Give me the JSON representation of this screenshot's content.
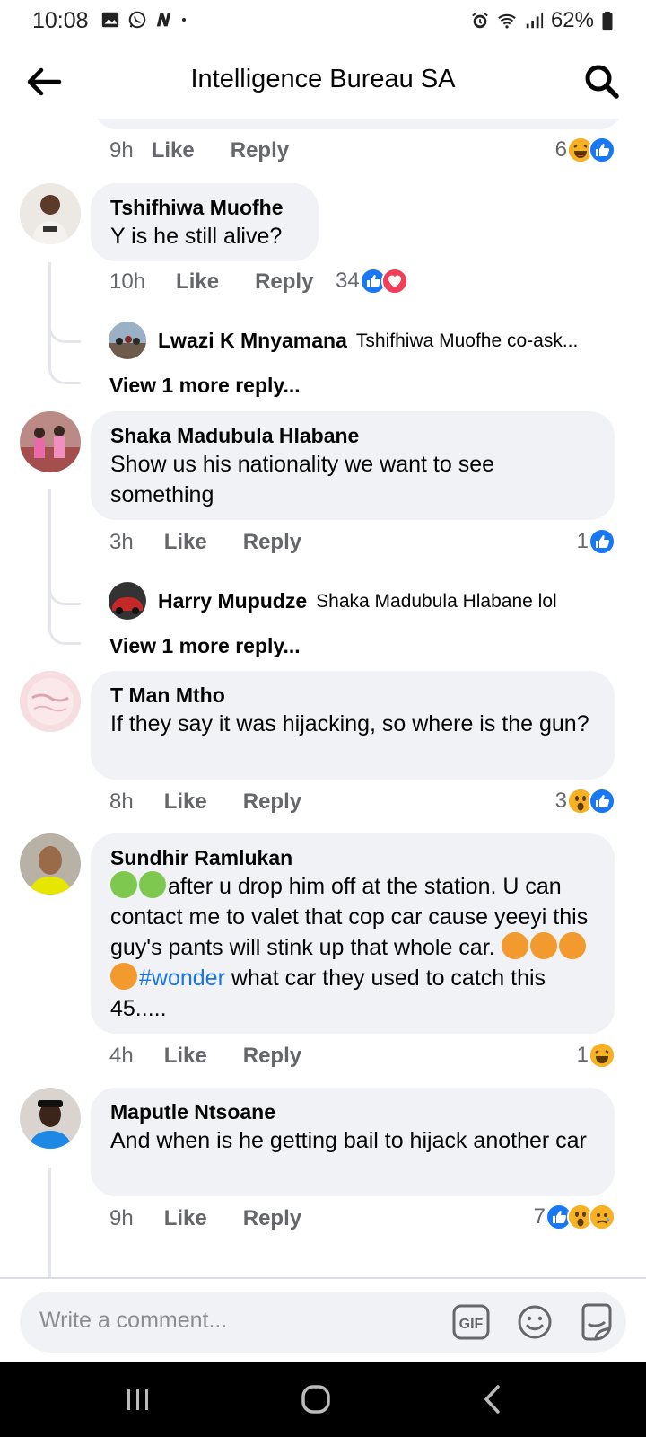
{
  "status_bar": {
    "time": "10:08",
    "battery": "62%"
  },
  "header": {
    "title": "Intelligence Bureau SA"
  },
  "top_item": {
    "time": "9h",
    "like": "Like",
    "reply": "Reply",
    "reaction_count": "6"
  },
  "comments": [
    {
      "name": "Tshifhiwa Muofhe",
      "text": "Y is he still alive?",
      "time": "10h",
      "like": "Like",
      "reply": "Reply",
      "reaction_count": "34",
      "reply_preview": {
        "name": "Lwazi K Mnyamana",
        "text": "Tshifhiwa Muofhe co-ask..."
      },
      "view_more": "View 1 more reply..."
    },
    {
      "name": "Shaka Madubula Hlabane",
      "text": "Show us his nationality we want to see something",
      "time": "3h",
      "like": "Like",
      "reply": "Reply",
      "reaction_count": "1",
      "reply_preview": {
        "name": "Harry Mupudze",
        "text": "Shaka Madubula Hlabane lol"
      },
      "view_more": "View 1 more reply..."
    },
    {
      "name": "T Man Mtho",
      "text": "If they say it was hijacking, so where is the gun?",
      "time": "8h",
      "like": "Like",
      "reply": "Reply",
      "reaction_count": "3"
    },
    {
      "name": "Sundhir Ramlukan",
      "text_part1": "after u drop him off at the station. U can contact me to valet that cop car cause yeeyi this guy's pants will stink up that whole car.",
      "hashtag": "#wonder",
      "text_part2": " what car they used to catch this 45.....",
      "time": "4h",
      "like": "Like",
      "reply": "Reply",
      "reaction_count": "1"
    },
    {
      "name": "Maputle Ntsoane",
      "text": "And when is he getting bail to hijack another car",
      "time": "9h",
      "like": "Like",
      "reply": "Reply",
      "reaction_count": "7"
    }
  ],
  "composer": {
    "placeholder": "Write a comment..."
  },
  "colors": {
    "like_blue": "#1877f2",
    "love_red": "#f33e58",
    "emoji_yellow": "#f7b125",
    "bubble_bg": "#f0f2f5",
    "hashtag": "#1b74e4"
  }
}
